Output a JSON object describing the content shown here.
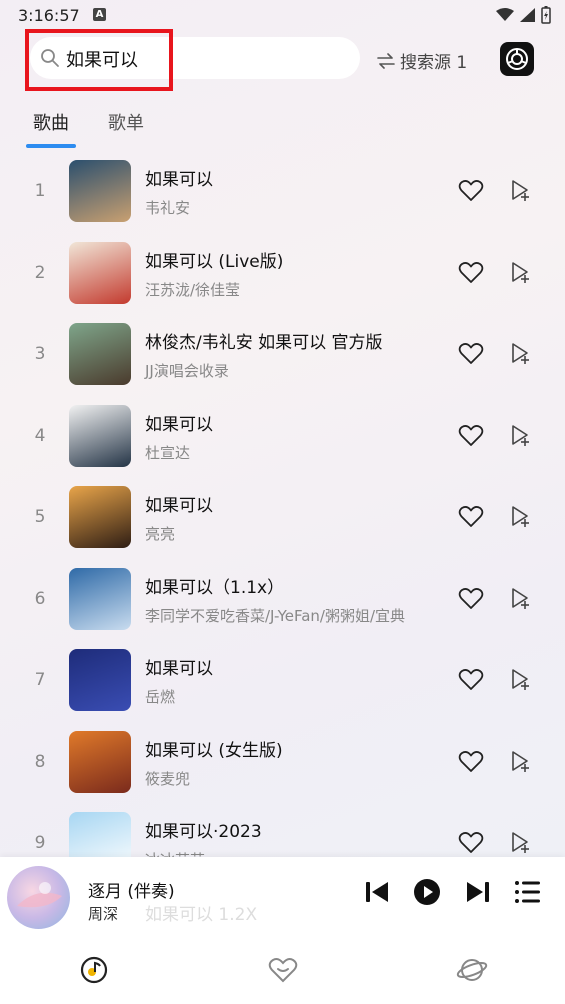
{
  "status": {
    "time": "3:16:57",
    "badge": "A"
  },
  "search": {
    "query": "如果可以",
    "source_label": "搜索源 1"
  },
  "tabs": [
    {
      "label": "歌曲"
    },
    {
      "label": "歌单"
    }
  ],
  "songs": [
    {
      "num": "1",
      "title": "如果可以",
      "artist": "韦礼安",
      "cover": [
        "#2b4f6e",
        "#c9a071"
      ]
    },
    {
      "num": "2",
      "title": "如果可以 (Live版)",
      "artist": "汪苏泷/徐佳莹",
      "cover": [
        "#f1e6d8",
        "#c33a2e"
      ]
    },
    {
      "num": "3",
      "title": "林俊杰/韦礼安 如果可以 官方版",
      "artist": "JJ演唱会收录",
      "cover": [
        "#7fa68b",
        "#4a3a2c"
      ]
    },
    {
      "num": "4",
      "title": "如果可以",
      "artist": "杜宣达",
      "cover": [
        "#f2f2f2",
        "#243446"
      ]
    },
    {
      "num": "5",
      "title": "如果可以",
      "artist": "亮亮",
      "cover": [
        "#e9a54a",
        "#2e1d14"
      ]
    },
    {
      "num": "6",
      "title": "如果可以（1.1x）",
      "artist": "李同学不爱吃香菜/J-YeFan/粥粥姐/宜典",
      "cover": [
        "#2f6aa7",
        "#c9dcef"
      ]
    },
    {
      "num": "7",
      "title": "如果可以",
      "artist": "岳燃",
      "cover": [
        "#1e2c7a",
        "#3a4db3"
      ]
    },
    {
      "num": "8",
      "title": "如果可以 (女生版)",
      "artist": "筱麦兜",
      "cover": [
        "#e07a2a",
        "#7a2a1c"
      ]
    },
    {
      "num": "9",
      "title": "如果可以·2023",
      "artist": "冰冰芸芸",
      "cover": [
        "#a7d6f2",
        "#ffffff"
      ]
    }
  ],
  "player": {
    "title": "逐月 (伴奏)",
    "artist": "周深",
    "ghost_text": "如果可以 1.2X"
  },
  "icons": {
    "search": "search-icon",
    "swap": "swap-icon",
    "app": "app-logo-icon",
    "heart": "heart-icon",
    "add_to_queue": "add-to-queue-icon",
    "prev": "skip-previous-icon",
    "play": "play-icon",
    "next": "skip-next-icon",
    "playlist": "playlist-icon",
    "music": "music-icon",
    "favorite": "favorite-icon",
    "discover": "planet-icon"
  },
  "colors": {
    "accent": "#2d8cf0",
    "highlight": "#e8151d"
  }
}
